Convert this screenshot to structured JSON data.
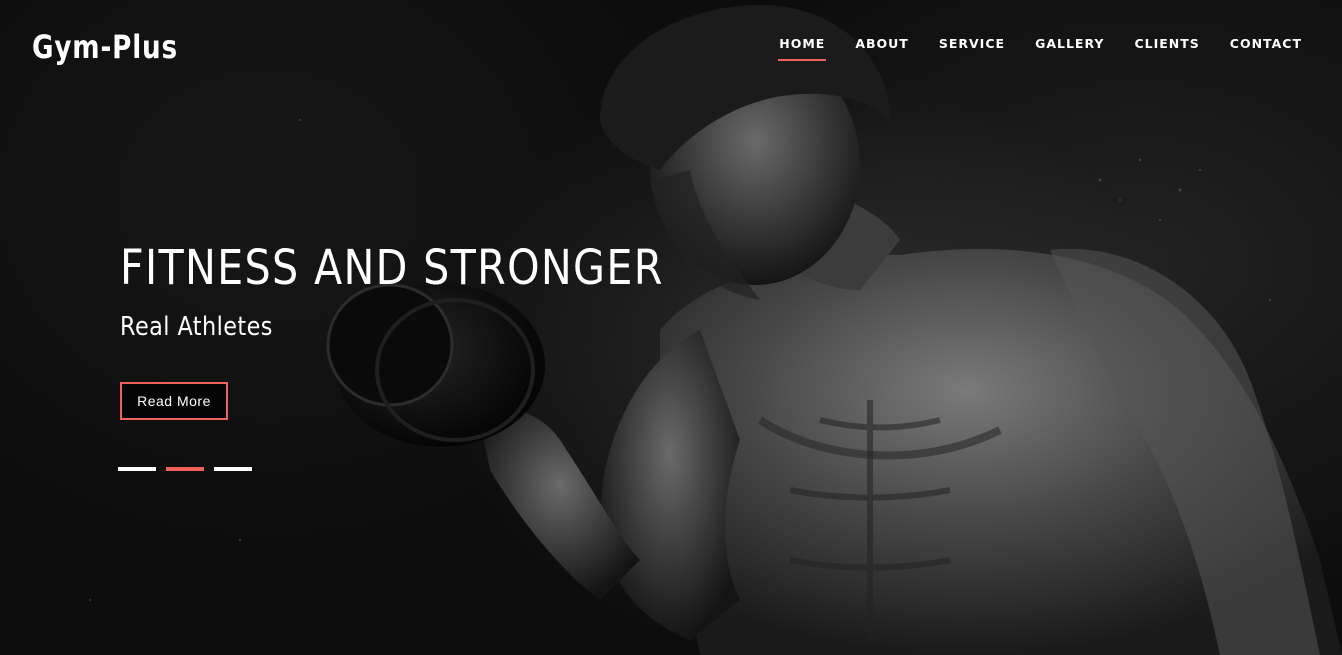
{
  "brand": {
    "logo": "Gym-Plus"
  },
  "nav": {
    "items": [
      {
        "label": "HOME",
        "active": true
      },
      {
        "label": "ABOUT",
        "active": false
      },
      {
        "label": "SERVICE",
        "active": false
      },
      {
        "label": "GALLERY",
        "active": false
      },
      {
        "label": "CLIENTS",
        "active": false
      },
      {
        "label": "CONTACT",
        "active": false
      }
    ]
  },
  "hero": {
    "headline": "FITNESS AND STRONGER",
    "subheadline": "Real Athletes",
    "cta_label": "Read More",
    "slides": [
      {
        "active": false
      },
      {
        "active": true
      },
      {
        "active": false
      }
    ],
    "background_image": "man-lifting-dumbbell-photo"
  },
  "colors": {
    "accent": "#f0615b",
    "text": "#ffffff",
    "background": "#0d0d0d"
  }
}
